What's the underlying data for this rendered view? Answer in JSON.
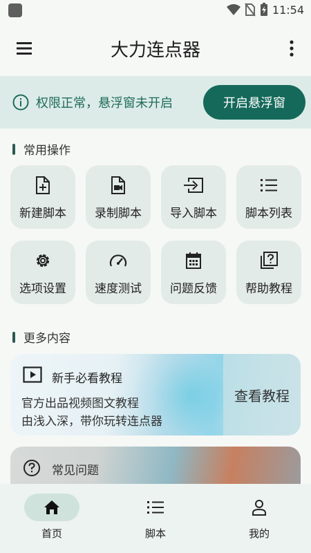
{
  "status_bar": {
    "time": "11:54"
  },
  "app_bar": {
    "title": "大力连点器"
  },
  "banner": {
    "message": "权限正常，悬浮窗未开启",
    "button": "开启悬浮窗"
  },
  "sections": {
    "common": "常用操作",
    "more": "更多内容"
  },
  "actions": [
    {
      "label": "新建脚本",
      "icon": "new-file-icon"
    },
    {
      "label": "录制脚本",
      "icon": "record-video-icon"
    },
    {
      "label": "导入脚本",
      "icon": "import-icon"
    },
    {
      "label": "脚本列表",
      "icon": "list-icon"
    },
    {
      "label": "选项设置",
      "icon": "gear-icon"
    },
    {
      "label": "速度测试",
      "icon": "speedometer-icon"
    },
    {
      "label": "问题反馈",
      "icon": "calendar-icon"
    },
    {
      "label": "帮助教程",
      "icon": "help-book-icon"
    }
  ],
  "tutorial_card": {
    "title": "新手必看教程",
    "line1": "官方出品视频图文教程",
    "line2": "由浅入深，带你玩转连点器",
    "action": "查看教程"
  },
  "faq_card": {
    "title": "常见问题"
  },
  "bottom_nav": [
    {
      "label": "首页",
      "icon": "home-icon",
      "active": true
    },
    {
      "label": "脚本",
      "icon": "list-icon",
      "active": false
    },
    {
      "label": "我的",
      "icon": "person-icon",
      "active": false
    }
  ],
  "colors": {
    "accent": "#15695a",
    "banner_bg": "#dcebe7",
    "tile_bg": "#e3ebe8"
  }
}
